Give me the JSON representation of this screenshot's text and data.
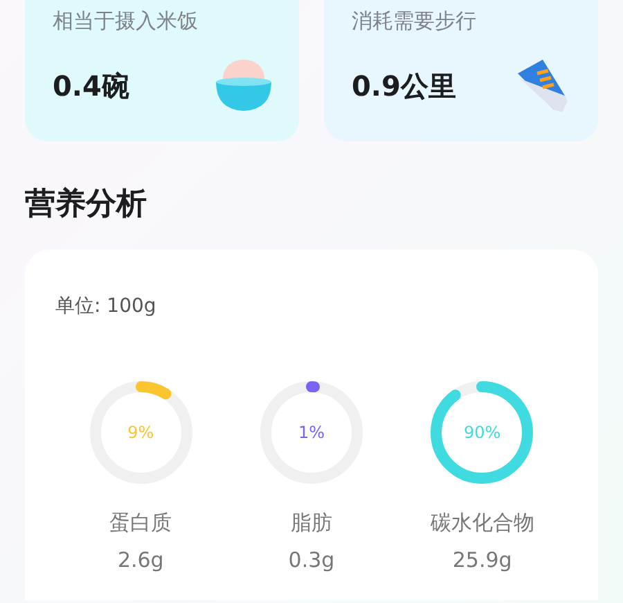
{
  "summary_cards": [
    {
      "kind": "rice",
      "label": "相当于摄入米饭",
      "value": "0.4碗"
    },
    {
      "kind": "shoe",
      "label": "消耗需要步行",
      "value": "0.9公里"
    }
  ],
  "nutrition": {
    "title": "营养分析",
    "unit": "单位: 100g",
    "nutrients": [
      {
        "name": "蛋白质",
        "amount": "2.6g",
        "percent": "9%",
        "color": "#fbc52f"
      },
      {
        "name": "脂肪",
        "amount": "0.3g",
        "percent": "1%",
        "color": "#7a63f5"
      },
      {
        "name": "碳水化合物",
        "amount": "25.9g",
        "percent": "90%",
        "color": "#40dbe0"
      }
    ]
  }
}
